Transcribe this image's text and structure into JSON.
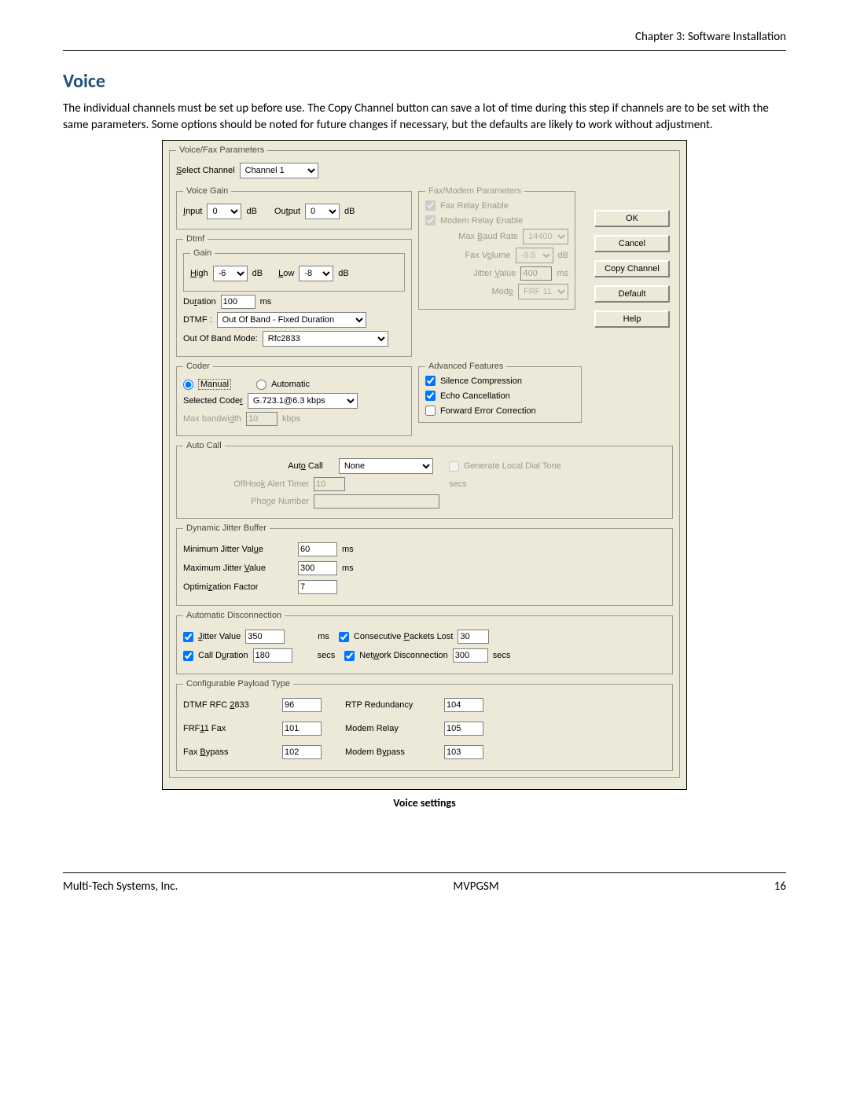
{
  "doc": {
    "chapter": "Chapter 3: Software Installation",
    "heading": "Voice",
    "intro": "The individual channels must be set up before use. The Copy Channel button can save a lot of time during this step if channels are to be set with the same parameters. Some options should be noted for future changes if necessary, but the defaults are likely to work without adjustment.",
    "caption": "Voice settings",
    "footer_left": "Multi-Tech Systems, Inc.",
    "footer_center": "MVPGSM",
    "footer_right": "16"
  },
  "dlg": {
    "groupTitle": "Voice/Fax Parameters",
    "selectChannelLabel": "Select Channel",
    "selectChannelValue": "Channel 1",
    "voiceGain": {
      "title": "Voice Gain",
      "inputLabel": "Input",
      "inputValue": "0",
      "outputLabel": "Output",
      "outputValue": "0",
      "unit": "dB"
    },
    "dtmf": {
      "title": "Dtmf",
      "gainTitle": "Gain",
      "highLabel": "High",
      "highValue": "-6",
      "lowLabel": "Low",
      "lowValue": "-8",
      "unit": "dB",
      "durationLabel": "Duration",
      "durationValue": "100",
      "durationUnit": "ms",
      "dtmfLabel": "DTMF :",
      "dtmfValue": "Out Of Band - Fixed Duration",
      "oobLabel": "Out Of Band Mode:",
      "oobValue": "Rfc2833"
    },
    "faxModem": {
      "title": "Fax/Modem Parameters",
      "faxRelay": "Fax Relay Enable",
      "modemRelay": "Modem Relay Enable",
      "maxBaudLabel": "Max Baud Rate",
      "maxBaudValue": "14400",
      "faxVolLabel": "Fax Volume",
      "faxVolValue": "-9.5",
      "faxVolUnit": "dB",
      "jitterLabel": "Jitter Value",
      "jitterValue": "400",
      "jitterUnit": "ms",
      "modeLabel": "Mode",
      "modeValue": "FRF 11"
    },
    "buttons": {
      "ok": "OK",
      "cancel": "Cancel",
      "copy": "Copy Channel",
      "default": "Default",
      "help": "Help"
    },
    "coder": {
      "title": "Coder",
      "manual": "Manual",
      "automatic": "Automatic",
      "selectedLabel": "Selected Coder",
      "selectedValue": "G.723.1@6.3 kbps",
      "maxBwLabel": "Max bandwidth",
      "maxBwValue": "10",
      "maxBwUnit": "kbps"
    },
    "adv": {
      "title": "Advanced Features",
      "silence": "Silence Compression",
      "echo": "Echo Cancellation",
      "fec": "Forward Error Correction"
    },
    "autocall": {
      "title": "Auto Call",
      "autoLabel": "Auto Call",
      "autoValue": "None",
      "genTone": "Generate Local Dial Tone",
      "offhookLabel": "OffHook Alert Timer",
      "offhookValue": "10",
      "offhookUnit": "secs",
      "phoneLabel": "Phone Number",
      "phoneValue": ""
    },
    "jitter": {
      "title": "Dynamic Jitter Buffer",
      "minLabel": "Minimum Jitter Value",
      "minValue": "60",
      "maxLabel": "Maximum Jitter Value",
      "maxValue": "300",
      "unit": "ms",
      "optLabel": "Optimization Factor",
      "optValue": "7"
    },
    "autodisc": {
      "title": "Automatic Disconnection",
      "jitterLabel": "Jitter Value",
      "jitterValue": "350",
      "jitterUnit": "ms",
      "packetsLabel": "Consecutive Packets Lost",
      "packetsValue": "30",
      "callDurLabel": "Call Duration",
      "callDurValue": "180",
      "callDurUnit": "secs",
      "netDiscLabel": "Network Disconnection",
      "netDiscValue": "300",
      "netDiscUnit": "secs"
    },
    "payload": {
      "title": "Configurable Payload Type",
      "dtmfLabel": "DTMF RFC 2833",
      "dtmfValue": "96",
      "rtpLabel": "RTP Redundancy",
      "rtpValue": "104",
      "frfLabel": "FRF11 Fax",
      "frfValue": "101",
      "modemRelayLabel": "Modem Relay",
      "modemRelayValue": "105",
      "faxBypassLabel": "Fax Bypass",
      "faxBypassValue": "102",
      "modemBypassLabel": "Modem Bypass",
      "modemBypassValue": "103"
    }
  }
}
